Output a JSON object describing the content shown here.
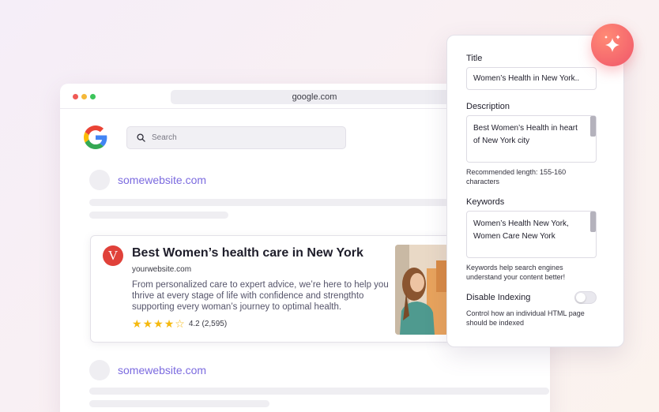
{
  "browser": {
    "url": "google.com",
    "search_placeholder": "Search"
  },
  "results": {
    "top_site": "somewebsite.com",
    "bottom_site": "somewebsite.com"
  },
  "featured": {
    "logo_letter": "V",
    "title": "Best Women’s health care in New York",
    "url": "yourwebsite.com",
    "description": "From personalized care to expert advice, we’re here to help you thrive at every stage of life with confidence and strengthto supporting every woman’s journey to optimal health.",
    "rating_value": 4.2,
    "rating_text": "4.2 (2,595)",
    "stars_filled": 4,
    "stars_total": 5
  },
  "seo_panel": {
    "title_label": "Title",
    "title_value": "Women’s Health in New York..",
    "description_label": "Description",
    "description_value": "Best Women’s Health in heart of New York city",
    "description_hint": "Recommended length: 155-160 characters",
    "keywords_label": "Keywords",
    "keywords_value": "Women’s Health New York, Women Care New York",
    "keywords_hint": "Keywords help search engines understand your content better!",
    "indexing_label": "Disable Indexing",
    "indexing_enabled": false,
    "indexing_hint": "Control how an individual HTML page should be indexed"
  },
  "colors": {
    "accent_purple": "#7b6adf",
    "logo_red": "#e0413a",
    "star_yellow": "#f5b90f",
    "sparkle_coral": "#f0566a"
  },
  "icons": {
    "search": "search-icon",
    "sparkle": "sparkle-icon",
    "google": "google-logo-icon"
  }
}
